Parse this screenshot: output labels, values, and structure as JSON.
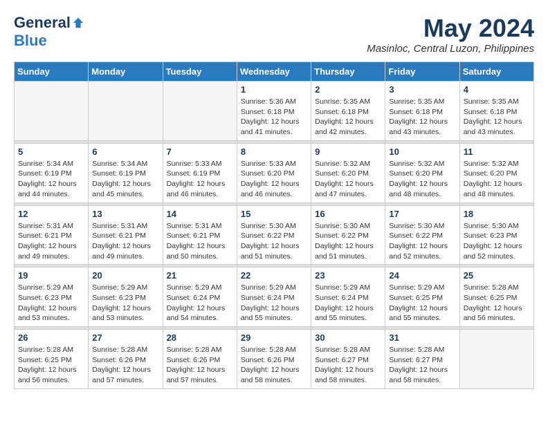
{
  "header": {
    "logo_general": "General",
    "logo_blue": "Blue",
    "month_title": "May 2024",
    "location": "Masinloc, Central Luzon, Philippines"
  },
  "weekdays": [
    "Sunday",
    "Monday",
    "Tuesday",
    "Wednesday",
    "Thursday",
    "Friday",
    "Saturday"
  ],
  "weeks": [
    [
      {
        "day": "",
        "sunrise": "",
        "sunset": "",
        "daylight": "",
        "empty": true
      },
      {
        "day": "",
        "sunrise": "",
        "sunset": "",
        "daylight": "",
        "empty": true
      },
      {
        "day": "",
        "sunrise": "",
        "sunset": "",
        "daylight": "",
        "empty": true
      },
      {
        "day": "1",
        "sunrise": "Sunrise: 5:36 AM",
        "sunset": "Sunset: 6:18 PM",
        "daylight": "Daylight: 12 hours and 41 minutes."
      },
      {
        "day": "2",
        "sunrise": "Sunrise: 5:35 AM",
        "sunset": "Sunset: 6:18 PM",
        "daylight": "Daylight: 12 hours and 42 minutes."
      },
      {
        "day": "3",
        "sunrise": "Sunrise: 5:35 AM",
        "sunset": "Sunset: 6:18 PM",
        "daylight": "Daylight: 12 hours and 43 minutes."
      },
      {
        "day": "4",
        "sunrise": "Sunrise: 5:35 AM",
        "sunset": "Sunset: 6:18 PM",
        "daylight": "Daylight: 12 hours and 43 minutes."
      }
    ],
    [
      {
        "day": "5",
        "sunrise": "Sunrise: 5:34 AM",
        "sunset": "Sunset: 6:19 PM",
        "daylight": "Daylight: 12 hours and 44 minutes."
      },
      {
        "day": "6",
        "sunrise": "Sunrise: 5:34 AM",
        "sunset": "Sunset: 6:19 PM",
        "daylight": "Daylight: 12 hours and 45 minutes."
      },
      {
        "day": "7",
        "sunrise": "Sunrise: 5:33 AM",
        "sunset": "Sunset: 6:19 PM",
        "daylight": "Daylight: 12 hours and 46 minutes."
      },
      {
        "day": "8",
        "sunrise": "Sunrise: 5:33 AM",
        "sunset": "Sunset: 6:20 PM",
        "daylight": "Daylight: 12 hours and 46 minutes."
      },
      {
        "day": "9",
        "sunrise": "Sunrise: 5:32 AM",
        "sunset": "Sunset: 6:20 PM",
        "daylight": "Daylight: 12 hours and 47 minutes."
      },
      {
        "day": "10",
        "sunrise": "Sunrise: 5:32 AM",
        "sunset": "Sunset: 6:20 PM",
        "daylight": "Daylight: 12 hours and 48 minutes."
      },
      {
        "day": "11",
        "sunrise": "Sunrise: 5:32 AM",
        "sunset": "Sunset: 6:20 PM",
        "daylight": "Daylight: 12 hours and 48 minutes."
      }
    ],
    [
      {
        "day": "12",
        "sunrise": "Sunrise: 5:31 AM",
        "sunset": "Sunset: 6:21 PM",
        "daylight": "Daylight: 12 hours and 49 minutes."
      },
      {
        "day": "13",
        "sunrise": "Sunrise: 5:31 AM",
        "sunset": "Sunset: 6:21 PM",
        "daylight": "Daylight: 12 hours and 49 minutes."
      },
      {
        "day": "14",
        "sunrise": "Sunrise: 5:31 AM",
        "sunset": "Sunset: 6:21 PM",
        "daylight": "Daylight: 12 hours and 50 minutes."
      },
      {
        "day": "15",
        "sunrise": "Sunrise: 5:30 AM",
        "sunset": "Sunset: 6:22 PM",
        "daylight": "Daylight: 12 hours and 51 minutes."
      },
      {
        "day": "16",
        "sunrise": "Sunrise: 5:30 AM",
        "sunset": "Sunset: 6:22 PM",
        "daylight": "Daylight: 12 hours and 51 minutes."
      },
      {
        "day": "17",
        "sunrise": "Sunrise: 5:30 AM",
        "sunset": "Sunset: 6:22 PM",
        "daylight": "Daylight: 12 hours and 52 minutes."
      },
      {
        "day": "18",
        "sunrise": "Sunrise: 5:30 AM",
        "sunset": "Sunset: 6:23 PM",
        "daylight": "Daylight: 12 hours and 52 minutes."
      }
    ],
    [
      {
        "day": "19",
        "sunrise": "Sunrise: 5:29 AM",
        "sunset": "Sunset: 6:23 PM",
        "daylight": "Daylight: 12 hours and 53 minutes."
      },
      {
        "day": "20",
        "sunrise": "Sunrise: 5:29 AM",
        "sunset": "Sunset: 6:23 PM",
        "daylight": "Daylight: 12 hours and 53 minutes."
      },
      {
        "day": "21",
        "sunrise": "Sunrise: 5:29 AM",
        "sunset": "Sunset: 6:24 PM",
        "daylight": "Daylight: 12 hours and 54 minutes."
      },
      {
        "day": "22",
        "sunrise": "Sunrise: 5:29 AM",
        "sunset": "Sunset: 6:24 PM",
        "daylight": "Daylight: 12 hours and 55 minutes."
      },
      {
        "day": "23",
        "sunrise": "Sunrise: 5:29 AM",
        "sunset": "Sunset: 6:24 PM",
        "daylight": "Daylight: 12 hours and 55 minutes."
      },
      {
        "day": "24",
        "sunrise": "Sunrise: 5:29 AM",
        "sunset": "Sunset: 6:25 PM",
        "daylight": "Daylight: 12 hours and 55 minutes."
      },
      {
        "day": "25",
        "sunrise": "Sunrise: 5:28 AM",
        "sunset": "Sunset: 6:25 PM",
        "daylight": "Daylight: 12 hours and 56 minutes."
      }
    ],
    [
      {
        "day": "26",
        "sunrise": "Sunrise: 5:28 AM",
        "sunset": "Sunset: 6:25 PM",
        "daylight": "Daylight: 12 hours and 56 minutes."
      },
      {
        "day": "27",
        "sunrise": "Sunrise: 5:28 AM",
        "sunset": "Sunset: 6:26 PM",
        "daylight": "Daylight: 12 hours and 57 minutes."
      },
      {
        "day": "28",
        "sunrise": "Sunrise: 5:28 AM",
        "sunset": "Sunset: 6:26 PM",
        "daylight": "Daylight: 12 hours and 57 minutes."
      },
      {
        "day": "29",
        "sunrise": "Sunrise: 5:28 AM",
        "sunset": "Sunset: 6:26 PM",
        "daylight": "Daylight: 12 hours and 58 minutes."
      },
      {
        "day": "30",
        "sunrise": "Sunrise: 5:28 AM",
        "sunset": "Sunset: 6:27 PM",
        "daylight": "Daylight: 12 hours and 58 minutes."
      },
      {
        "day": "31",
        "sunrise": "Sunrise: 5:28 AM",
        "sunset": "Sunset: 6:27 PM",
        "daylight": "Daylight: 12 hours and 58 minutes."
      },
      {
        "day": "",
        "sunrise": "",
        "sunset": "",
        "daylight": "",
        "empty": true
      }
    ]
  ]
}
